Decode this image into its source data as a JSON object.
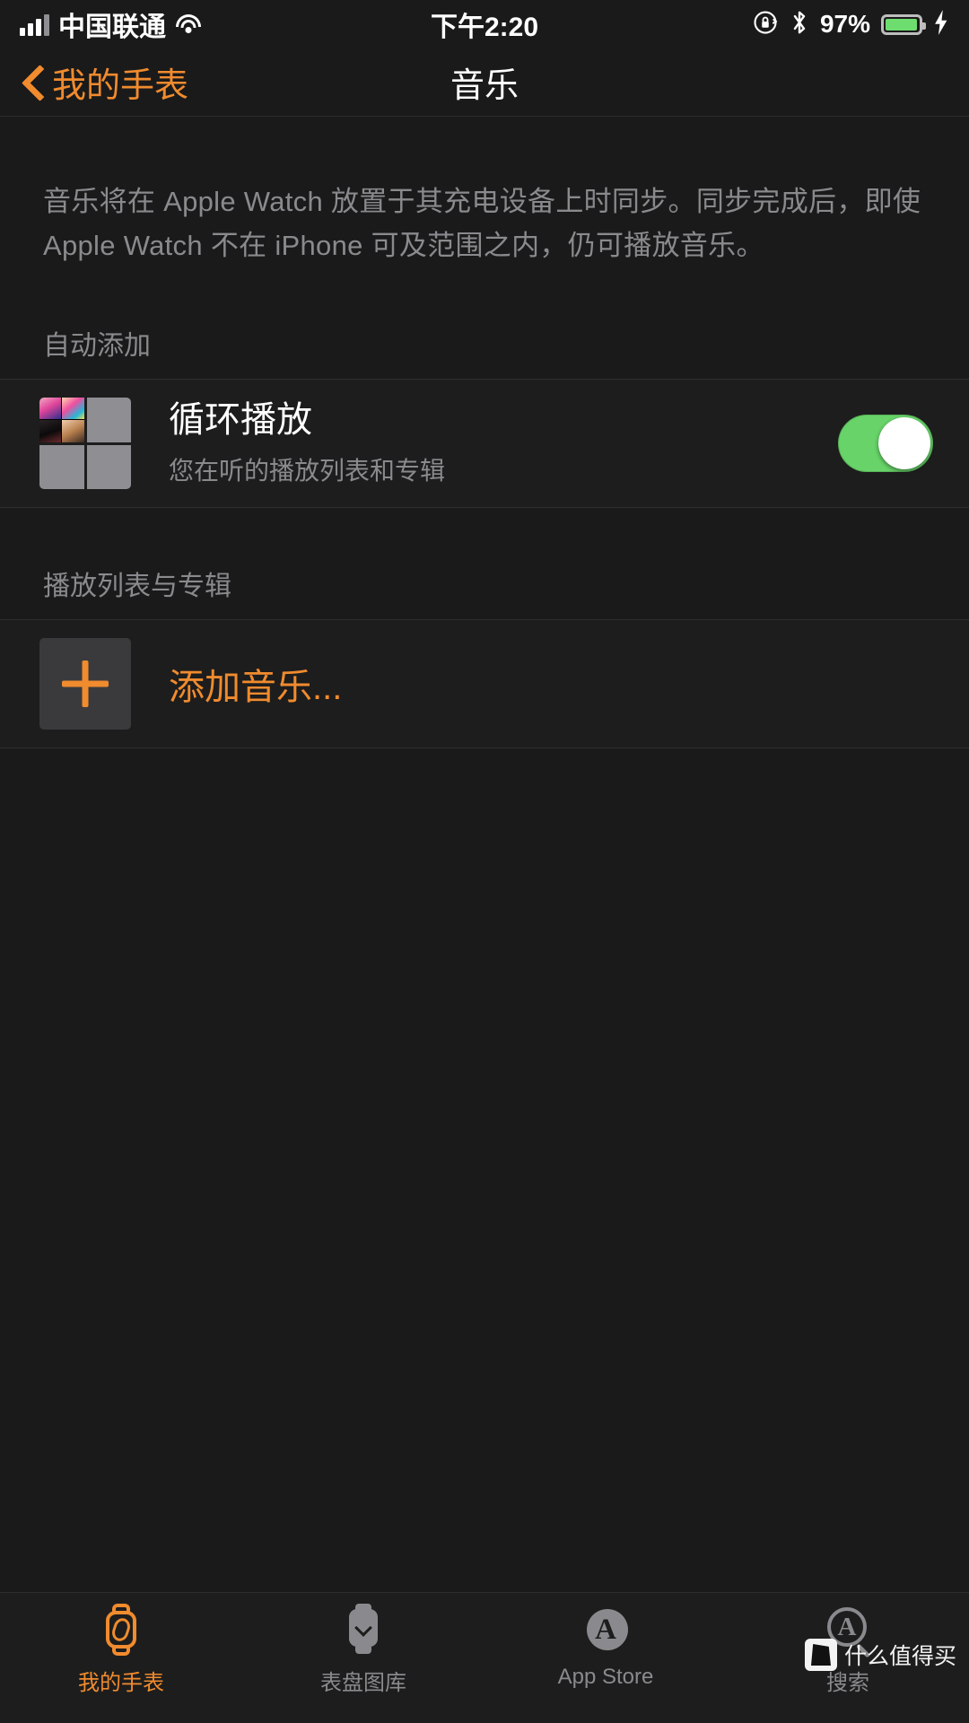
{
  "status_bar": {
    "carrier": "中国联通",
    "signal_icon": "signal-bars-icon",
    "wifi_icon": "wifi-icon",
    "time": "下午2:20",
    "rotation_lock_icon": "rotation-lock-icon",
    "bluetooth_icon": "bluetooth-icon",
    "battery_percent": "97%",
    "battery_level": 97,
    "battery_color": "#6edd70",
    "charging_icon": "charging-bolt-icon"
  },
  "nav_bar": {
    "back_label": "我的手表",
    "back_icon": "chevron-left-icon",
    "title": "音乐",
    "accent_color": "#f08b2e"
  },
  "main": {
    "description": "音乐将在 Apple Watch 放置于其充电设备上时同步。同步完成后，即使 Apple Watch 不在 iPhone 可及范围之内，仍可播放音乐。",
    "sections": [
      {
        "header": "自动添加",
        "rows": [
          {
            "artwork_icon": "album-art-mosaic",
            "title": "循环播放",
            "subtitle": "您在听的播放列表和专辑",
            "toggle": {
              "name": "loop-playback-toggle",
              "state": "on",
              "on_color": "#67d368"
            }
          }
        ]
      },
      {
        "header": "播放列表与专辑",
        "rows": [
          {
            "icon": "plus-icon",
            "label": "添加音乐..."
          }
        ]
      }
    ]
  },
  "tab_bar": {
    "tabs": [
      {
        "label": "我的手表",
        "icon": "watch-icon",
        "active": true
      },
      {
        "label": "表盘图库",
        "icon": "face-gallery-icon",
        "active": false
      },
      {
        "label": "App Store",
        "icon": "app-store-icon",
        "active": false
      },
      {
        "label": "搜索",
        "icon": "search-icon",
        "active": false
      }
    ]
  },
  "watermark": {
    "text": "什么值得买"
  }
}
